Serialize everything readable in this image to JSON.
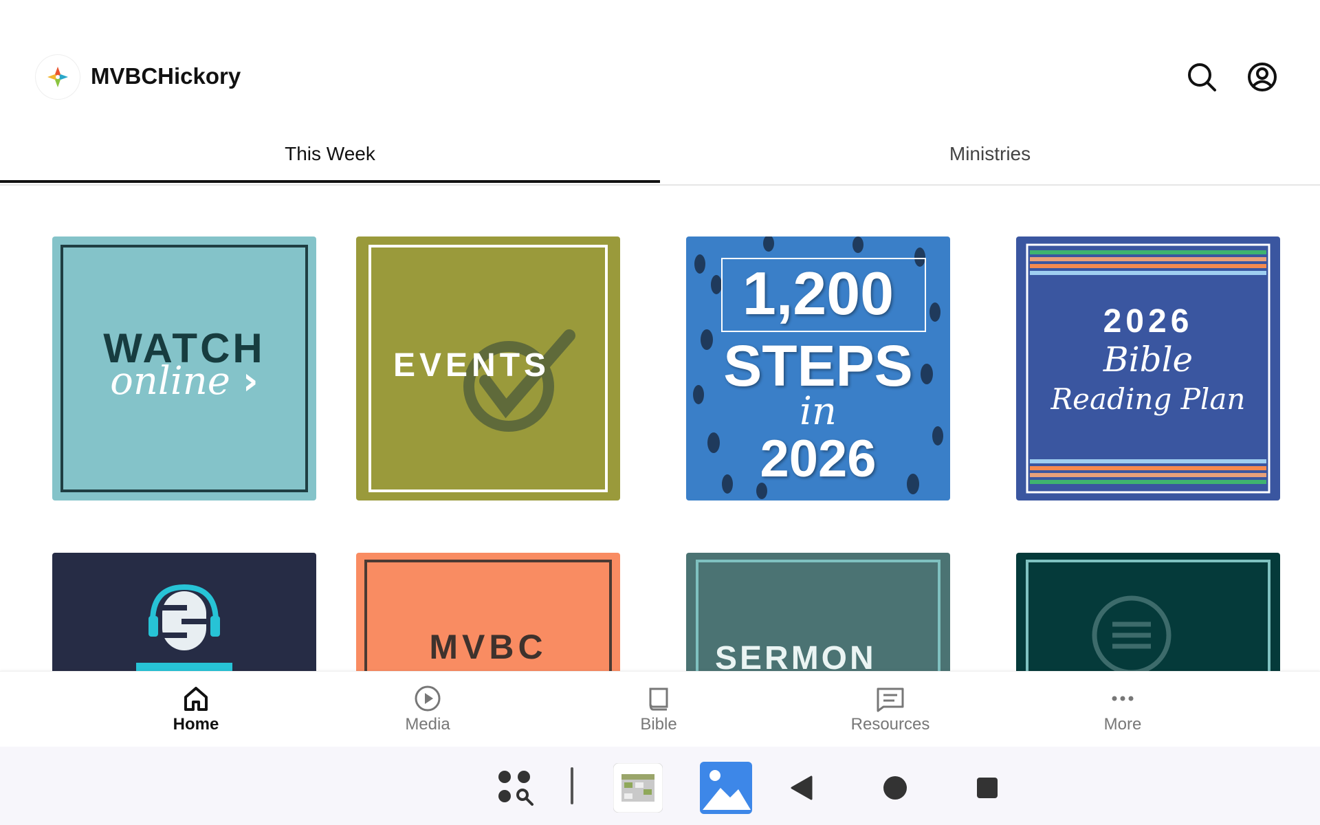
{
  "header": {
    "title": "MVBCHickory",
    "logo_icon": "church-cross-logo-icon",
    "search_icon": "search-icon",
    "account_icon": "account-circle-icon"
  },
  "tabs": [
    {
      "label": "This Week",
      "active": true
    },
    {
      "label": "Ministries",
      "active": false
    }
  ],
  "tiles": [
    {
      "text_line1": "WATCH",
      "text_line2": "online",
      "bg": "#84c3c9",
      "border": "#1f3e42"
    },
    {
      "text_line1": "EVENTS",
      "bg": "#9a9a3b",
      "border": "#ffffff"
    },
    {
      "text_line1": "1,200",
      "text_line2": "STEPS",
      "text_line3": "in",
      "text_line4": "2026",
      "bg": "#3a7fc8"
    },
    {
      "text_line1": "2026",
      "text_line2": "Bible",
      "text_line3": "Reading Plan",
      "bg": "#3a56a0"
    },
    {
      "bg": "#262c45",
      "icon": "podcast-microphone-icon"
    },
    {
      "text_line1": "MVBC",
      "bg": "#f98c62",
      "border": "#4a3a33"
    },
    {
      "text_line1": "SERMON",
      "bg": "#4b7373",
      "border": "#7fc1c0"
    },
    {
      "bg": "#053a3a",
      "border": "#7fc1c0",
      "icon": "chat-bubble-icon"
    }
  ],
  "bottom_nav": [
    {
      "label": "Home",
      "icon": "home-icon",
      "active": true
    },
    {
      "label": "Media",
      "icon": "play-circle-icon",
      "active": false
    },
    {
      "label": "Bible",
      "icon": "book-icon",
      "active": false
    },
    {
      "label": "Resources",
      "icon": "message-box-icon",
      "active": false
    },
    {
      "label": "More",
      "icon": "more-dots-icon",
      "active": false
    }
  ],
  "system_bar": {
    "items": [
      "app-drawer-search-icon",
      "calendar-app-icon",
      "gallery-app-icon",
      "back-icon",
      "home-circle-icon",
      "recents-square-icon"
    ]
  }
}
